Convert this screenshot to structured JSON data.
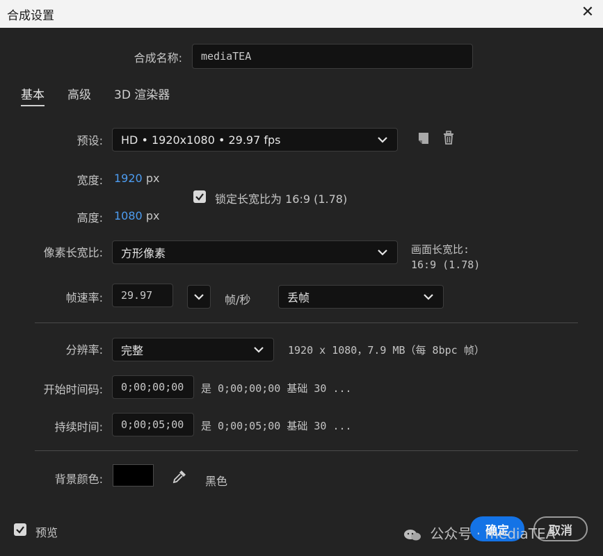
{
  "window": {
    "title": "合成设置",
    "close_glyph": "✕"
  },
  "comp_name": {
    "label": "合成名称:",
    "value": "mediaTEA"
  },
  "tabs": [
    {
      "label": "基本",
      "active": true
    },
    {
      "label": "高级",
      "active": false
    },
    {
      "label": "3D 渲染器",
      "active": false
    }
  ],
  "preset": {
    "label": "预设:",
    "value": "HD • 1920x1080 • 29.97 fps",
    "save_icon": "save-preset-icon",
    "delete_icon": "trash-icon"
  },
  "width": {
    "label": "宽度:",
    "value": "1920",
    "unit": "px"
  },
  "height": {
    "label": "高度:",
    "value": "1080",
    "unit": "px"
  },
  "lock_aspect": {
    "label": "锁定长宽比为 16:9 (1.78)",
    "checked": true
  },
  "pixel_aspect": {
    "label": "像素长宽比:",
    "value": "方形像素",
    "frame_aspect_label": "画面长宽比:",
    "frame_aspect_value": "16:9 (1.78)"
  },
  "frame_rate": {
    "label": "帧速率:",
    "value": "29.97",
    "unit": "帧/秒",
    "drop_value": "丢帧"
  },
  "resolution": {
    "label": "分辨率:",
    "value": "完整",
    "info": "1920 x 1080，7.9 MB（每 8bpc 帧）"
  },
  "start_timecode": {
    "label": "开始时间码:",
    "value": "0;00;00;00",
    "info": "是 0;00;00;00  基础 30  ..."
  },
  "duration": {
    "label": "持续时间:",
    "value": "0;00;05;00",
    "info": "是 0;00;05;00  基础 30  ..."
  },
  "background": {
    "label": "背景颜色:",
    "color": "#000000",
    "color_name": "黑色"
  },
  "preview": {
    "label": "预览",
    "checked": true
  },
  "buttons": {
    "ok": "确定",
    "cancel": "取消"
  },
  "watermark": {
    "text": "公众号 · mediaTEA"
  },
  "colors": {
    "accent": "#1473e6",
    "value_blue": "#4d9cf0",
    "bg": "#232323"
  }
}
